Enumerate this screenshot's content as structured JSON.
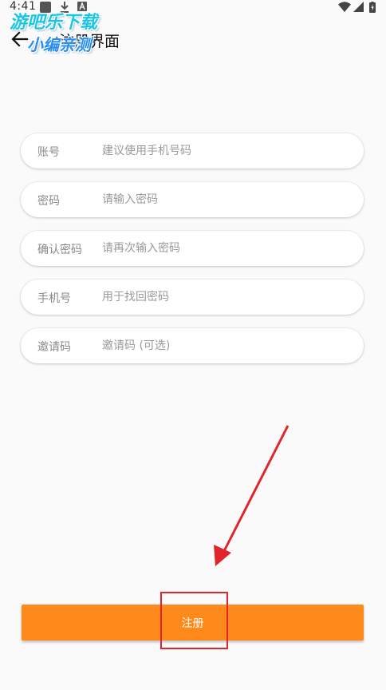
{
  "status_bar": {
    "time": "4:41",
    "icons": [
      "gallery-icon",
      "download-icon",
      "a-icon",
      "wifi-icon",
      "signal-icon",
      "battery-icon"
    ]
  },
  "watermark": {
    "line1": "游吧乐下载",
    "line2": "小编亲测"
  },
  "header": {
    "back_icon": "arrow-left-icon",
    "title": "注册界面"
  },
  "form": {
    "fields": [
      {
        "label": "账号",
        "placeholder": "建议使用手机号码",
        "value": ""
      },
      {
        "label": "密码",
        "placeholder": "请输入密码",
        "value": ""
      },
      {
        "label": "确认密码",
        "placeholder": "请再次输入密码",
        "value": ""
      },
      {
        "label": "手机号",
        "placeholder": "用于找回密码",
        "value": ""
      },
      {
        "label": "邀请码",
        "placeholder": "邀请码 (可选)",
        "value": ""
      }
    ]
  },
  "register_button": {
    "label": "注册"
  },
  "colors": {
    "background": "#fafafa",
    "accent": "#ff8a1c",
    "annotation": "#e0262c",
    "watermark": "#19c6e6"
  }
}
